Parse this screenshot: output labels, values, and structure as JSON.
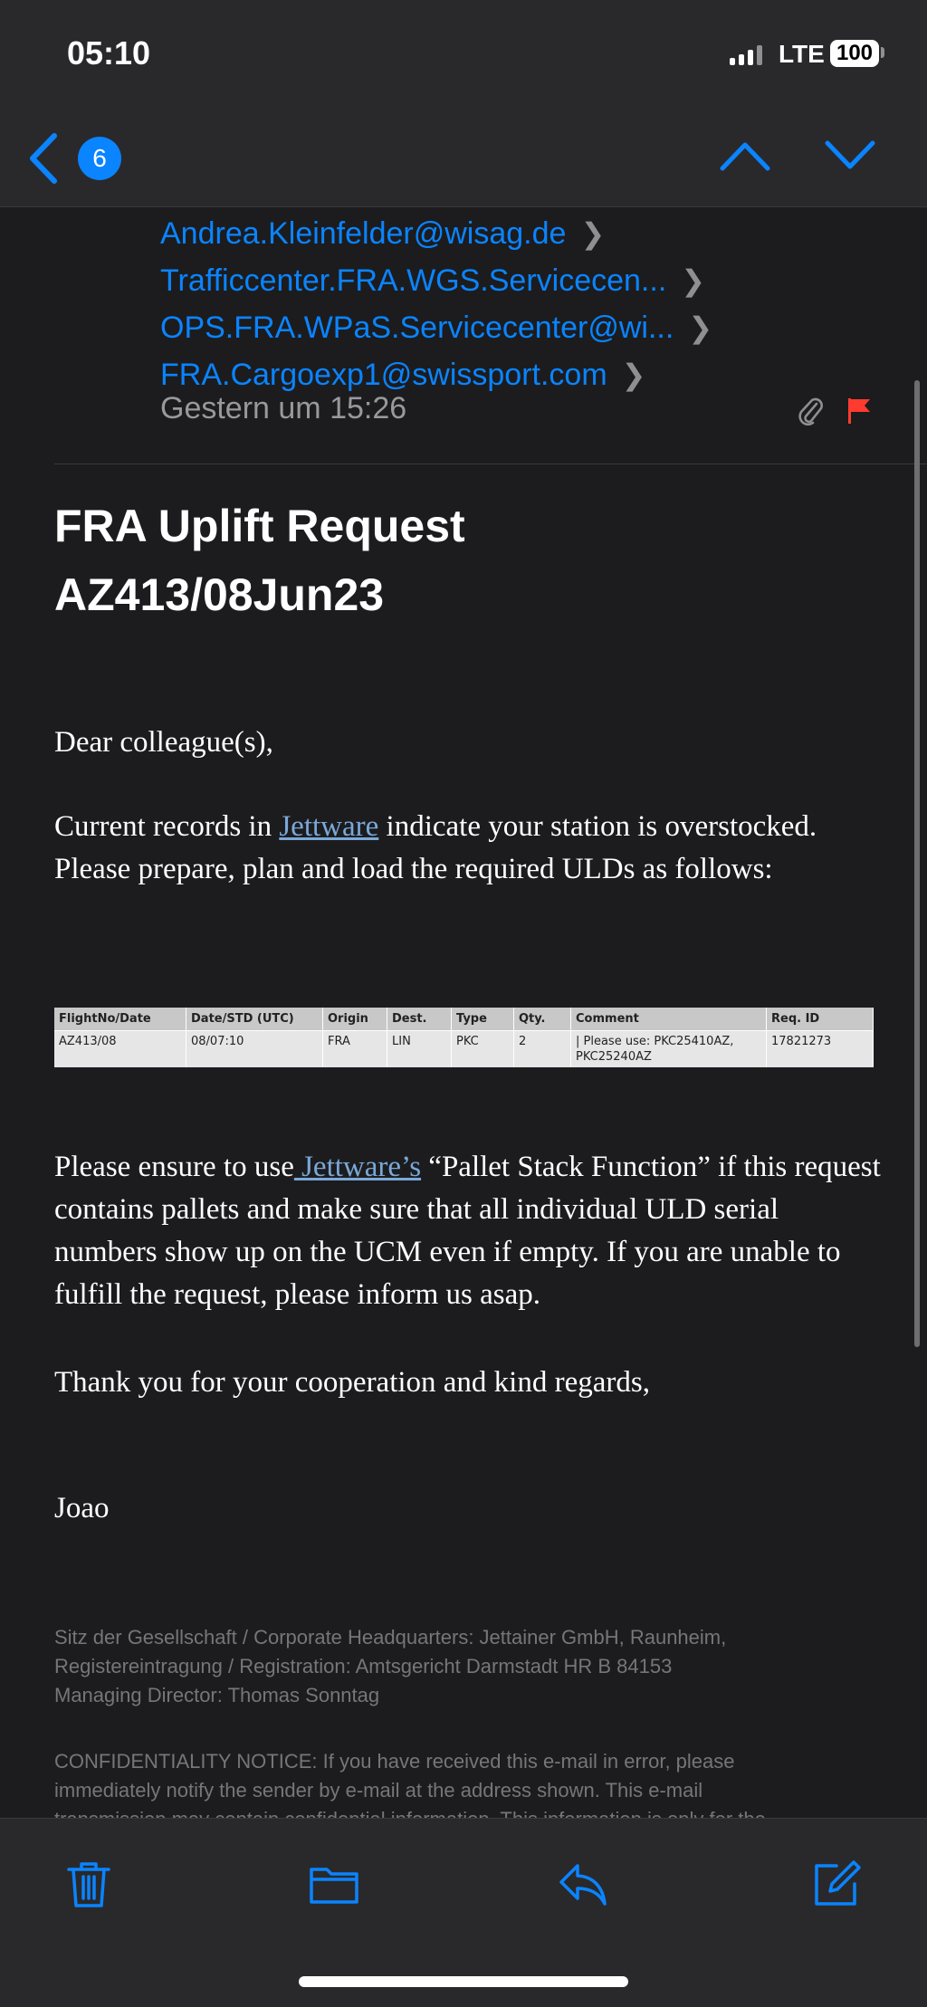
{
  "status_bar": {
    "time": "05:10",
    "network": "LTE",
    "battery": "100"
  },
  "nav": {
    "unread_count": "6"
  },
  "recipients": [
    "Andrea.Kleinfelder@wisag.de",
    "Trafficcenter.FRA.WGS.Servicecen...",
    "OPS.FRA.WPaS.Servicecenter@wi...",
    "FRA.Cargoexp1@swissport.com"
  ],
  "date": "Gestern um 15:26",
  "subject": {
    "line1": "FRA Uplift Request",
    "line2": "AZ413/08Jun23"
  },
  "body": {
    "greeting": "Dear colleague(s),",
    "p1_before": "Current records in ",
    "p1_link": "Jettware",
    "p1_after": " indicate your station is overstocked. Please prepare, plan and load the required ULDs as follows:",
    "p2_before": "Please ensure to use",
    "p2_link": " Jettware’s",
    "p2_after": " “Pallet Stack Function” if this request contains pallets and make sure that all individual ULD serial numbers show up on the UCM even if empty. If you are unable to fulfill the request, please inform us asap.",
    "thanks": "Thank you for your cooperation and kind regards,",
    "signature": "Joao"
  },
  "table": {
    "headers": [
      "FlightNo/Date",
      "Date/STD (UTC)",
      "Origin",
      "Dest.",
      "Type",
      "Qty.",
      "Comment",
      "Req. ID"
    ],
    "rows": [
      [
        "AZ413/08",
        "08/07:10",
        "FRA",
        "LIN",
        "PKC",
        "2",
        "| Please use: PKC25410AZ, PKC25240AZ",
        "17821273"
      ]
    ]
  },
  "footer": {
    "l1": "Sitz der Gesellschaft / Corporate Headquarters: Jettainer GmbH, Raunheim,",
    "l2": "Registereintragung / Registration: Amtsgericht Darmstadt HR B 84153",
    "l3": "Managing Director: Thomas Sonntag",
    "c1": "CONFIDENTIALITY NOTICE: If you have received this e-mail in error, please",
    "c2": "immediately notify the sender by e-mail at the address shown. This e-mail",
    "c3": "transmission may contain confidential information. This information is only for the"
  },
  "colors": {
    "accent": "#0a84ff",
    "flag": "#ff3b30",
    "background": "#1c1c1e",
    "bar": "#29292b"
  },
  "icons": [
    "back-chevron-icon",
    "previous-message-icon",
    "next-message-icon",
    "attachment-icon",
    "flag-icon",
    "trash-icon",
    "folder-icon",
    "reply-icon",
    "compose-icon"
  ]
}
